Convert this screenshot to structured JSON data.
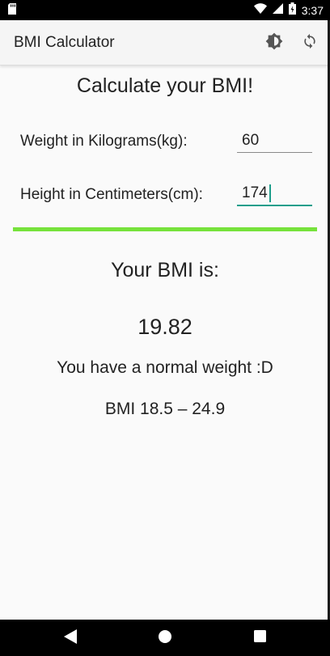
{
  "status_bar": {
    "time": "3:37"
  },
  "toolbar": {
    "title": "BMI Calculator",
    "actions": [
      {
        "name": "theme",
        "icon": "brightness-icon"
      },
      {
        "name": "refresh",
        "icon": "refresh-icon"
      }
    ]
  },
  "form": {
    "heading": "Calculate your BMI!",
    "weight": {
      "label": "Weight in Kilograms(kg):",
      "value": "60"
    },
    "height": {
      "label": "Height in Centimeters(cm):",
      "value": "174"
    }
  },
  "result": {
    "title": "Your BMI is:",
    "value": "19.82",
    "message": "You have a normal weight :D",
    "range": "BMI 18.5 – 24.9"
  },
  "colors": {
    "divider": "#76e23b",
    "accent": "#1e9e8b",
    "toolbar_bg": "#f5f5f5",
    "background": "#fafafa"
  },
  "nav_bar": {
    "buttons": [
      {
        "name": "back",
        "icon": "back-triangle-icon"
      },
      {
        "name": "home",
        "icon": "home-circle-icon"
      },
      {
        "name": "recents",
        "icon": "recents-square-icon"
      }
    ]
  }
}
